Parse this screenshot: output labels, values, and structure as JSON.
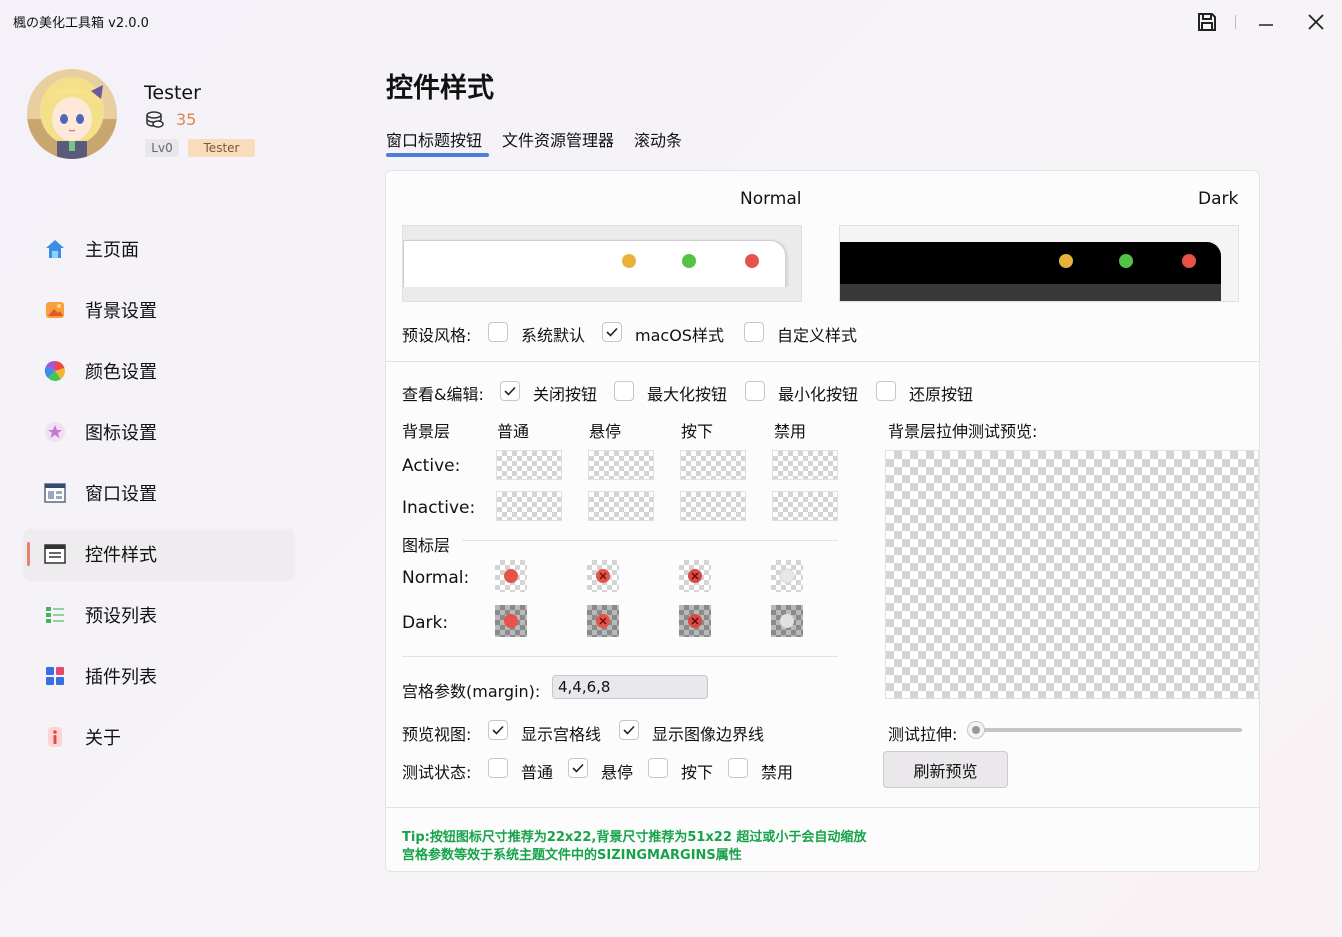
{
  "app": {
    "title": "楓の美化工具箱 v2.0.0"
  },
  "user": {
    "name": "Tester",
    "coins": "35",
    "level": "Lv0",
    "title_badge": "Tester"
  },
  "nav": {
    "items": [
      {
        "label": "主页面",
        "icon": "home-icon"
      },
      {
        "label": "背景设置",
        "icon": "image-icon"
      },
      {
        "label": "颜色设置",
        "icon": "color-wheel-icon"
      },
      {
        "label": "图标设置",
        "icon": "star-icon"
      },
      {
        "label": "窗口设置",
        "icon": "window-icon"
      },
      {
        "label": "控件样式",
        "icon": "controls-icon"
      },
      {
        "label": "预设列表",
        "icon": "list-icon"
      },
      {
        "label": "插件列表",
        "icon": "apps-icon"
      },
      {
        "label": "关于",
        "icon": "info-icon"
      }
    ],
    "active": "控件样式"
  },
  "page": {
    "title": "控件样式",
    "tabs": [
      "窗口标题按钮",
      "文件资源管理器",
      "滚动条"
    ],
    "active_tab": "窗口标题按钮"
  },
  "preview": {
    "normal_label": "Normal",
    "dark_label": "Dark"
  },
  "preset": {
    "label": "预设风格:",
    "options": [
      {
        "label": "系统默认",
        "checked": false
      },
      {
        "label": "macOS样式",
        "checked": true
      },
      {
        "label": "自定义样式",
        "checked": false
      }
    ]
  },
  "view_edit": {
    "label": "查看&编辑:",
    "options": [
      {
        "label": "关闭按钮",
        "checked": true
      },
      {
        "label": "最大化按钮",
        "checked": false
      },
      {
        "label": "最小化按钮",
        "checked": false
      },
      {
        "label": "还原按钮",
        "checked": false
      }
    ]
  },
  "grid": {
    "bg_layer_label": "背景层",
    "states": [
      "普通",
      "悬停",
      "按下",
      "禁用"
    ],
    "active_label": "Active:",
    "inactive_label": "Inactive:",
    "icon_layer_label": "图标层",
    "normal_label": "Normal:",
    "dark_label": "Dark:"
  },
  "stretch_preview_label": "背景层拉伸测试预览:",
  "margin": {
    "label": "宫格参数(margin):",
    "value": "4,4,6,8"
  },
  "preview_view": {
    "label": "预览视图:",
    "options": [
      {
        "label": "显示宫格线",
        "checked": true
      },
      {
        "label": "显示图像边界线",
        "checked": true
      }
    ]
  },
  "test_state": {
    "label": "测试状态:",
    "options": [
      {
        "label": "普通",
        "checked": false
      },
      {
        "label": "悬停",
        "checked": true
      },
      {
        "label": "按下",
        "checked": false
      },
      {
        "label": "禁用",
        "checked": false
      }
    ]
  },
  "test_stretch": {
    "label": "测试拉伸:",
    "value": 0
  },
  "refresh_label": "刷新预览",
  "tips": [
    "Tip:按钮图标尺寸推荐为22x22,背景尺寸推荐为51x22 超过或小于会自动缩放",
    "宫格参数等效于系统主题文件中的SIZINGMARGINS属性"
  ],
  "colors": {
    "accent": "#4c7fd8",
    "nav_indicator": "#e8826a",
    "mac_red": "#e5534b",
    "mac_yellow": "#e8b23a",
    "mac_green": "#54c245",
    "tip_green": "#16a34a",
    "coin_orange": "#e0844d"
  }
}
